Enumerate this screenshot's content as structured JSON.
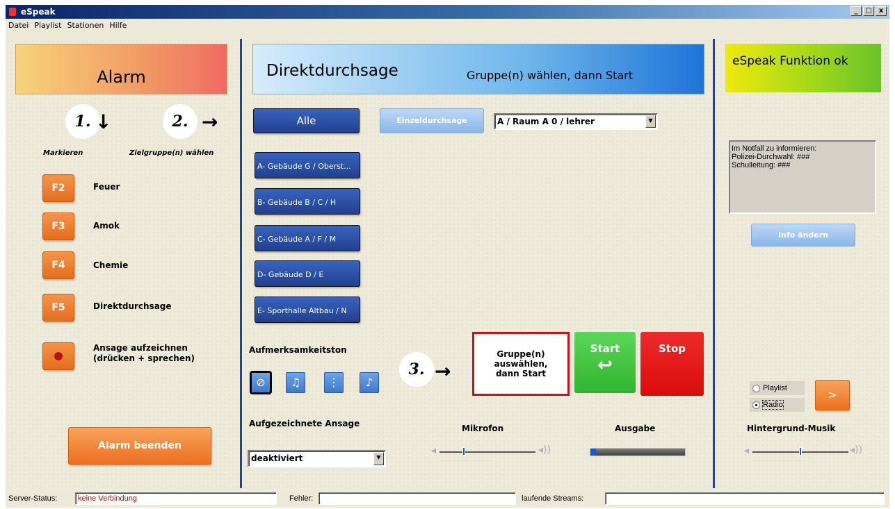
{
  "window": {
    "title": "eSpeak",
    "controls": [
      "_",
      "□",
      "x"
    ]
  },
  "menu": [
    "Datei",
    "Playlist",
    "Stationen",
    "Hilfe"
  ],
  "left": {
    "banner": "Alarm",
    "step1": "1.",
    "step2": "2.",
    "hint1": "Markieren",
    "hint2": "Zielgruppe(n) wählen",
    "keys": [
      {
        "key": "F2",
        "label": "Feuer"
      },
      {
        "key": "F3",
        "label": "Amok"
      },
      {
        "key": "F4",
        "label": "Chemie"
      },
      {
        "key": "F5",
        "label": "Direktdurchsage"
      }
    ],
    "record_label": "Ansage aufzeichnen (drücken + sprechen)",
    "end_button": "Alarm beenden"
  },
  "center": {
    "banner_title": "Direktdurchsage",
    "banner_sub": "Gruppe(n) wählen, dann Start",
    "alle": "Alle",
    "einzel": "Einzeldurchsage",
    "room_select": "A / Raum A 0 / lehrer",
    "groups": [
      "A- Gebäude G / Oberst...",
      "B- Gebäude B / C / H",
      "C- Gebäude A / F / M",
      "D- Gebäude D / E",
      "E- Sporthalle Altbau / N"
    ],
    "attention_label": "Aufmerksamkeitston",
    "step3": "3.",
    "hint_box": "Gruppe(n) auswählen, dann Start",
    "start": "Start",
    "stop": "Stop",
    "recorded_label": "Aufgezeichnete Ansage",
    "recorded_select": "deaktiviert",
    "mic_label": "Mikrofon",
    "out_label": "Ausgabe",
    "mic_level": 0.25,
    "output_level": 0.06
  },
  "right": {
    "banner": "eSpeak Funktion ok",
    "info_lines": [
      "Im Notfall zu informieren:",
      "Polizei-Durchwahl: ###",
      "Schulleitung: ###"
    ],
    "info_button": "Info ändern",
    "radio_playlist": "Playlist",
    "radio_radio": "Radio",
    "radio_selected": "Radio",
    "next_button": ">",
    "bg_label": "Hintergrund-Musik",
    "bg_level": 0.5
  },
  "status": {
    "server_label": "Server-Status:",
    "server_value": "keine Verbindung",
    "error_label": "Fehler:",
    "error_value": "",
    "streams_label": "laufende Streams:",
    "streams_value": ""
  },
  "colors": {
    "accent": "#1f3fae",
    "error_text": "#d00000",
    "stop": "#e01010",
    "start": "#3cc13a"
  }
}
